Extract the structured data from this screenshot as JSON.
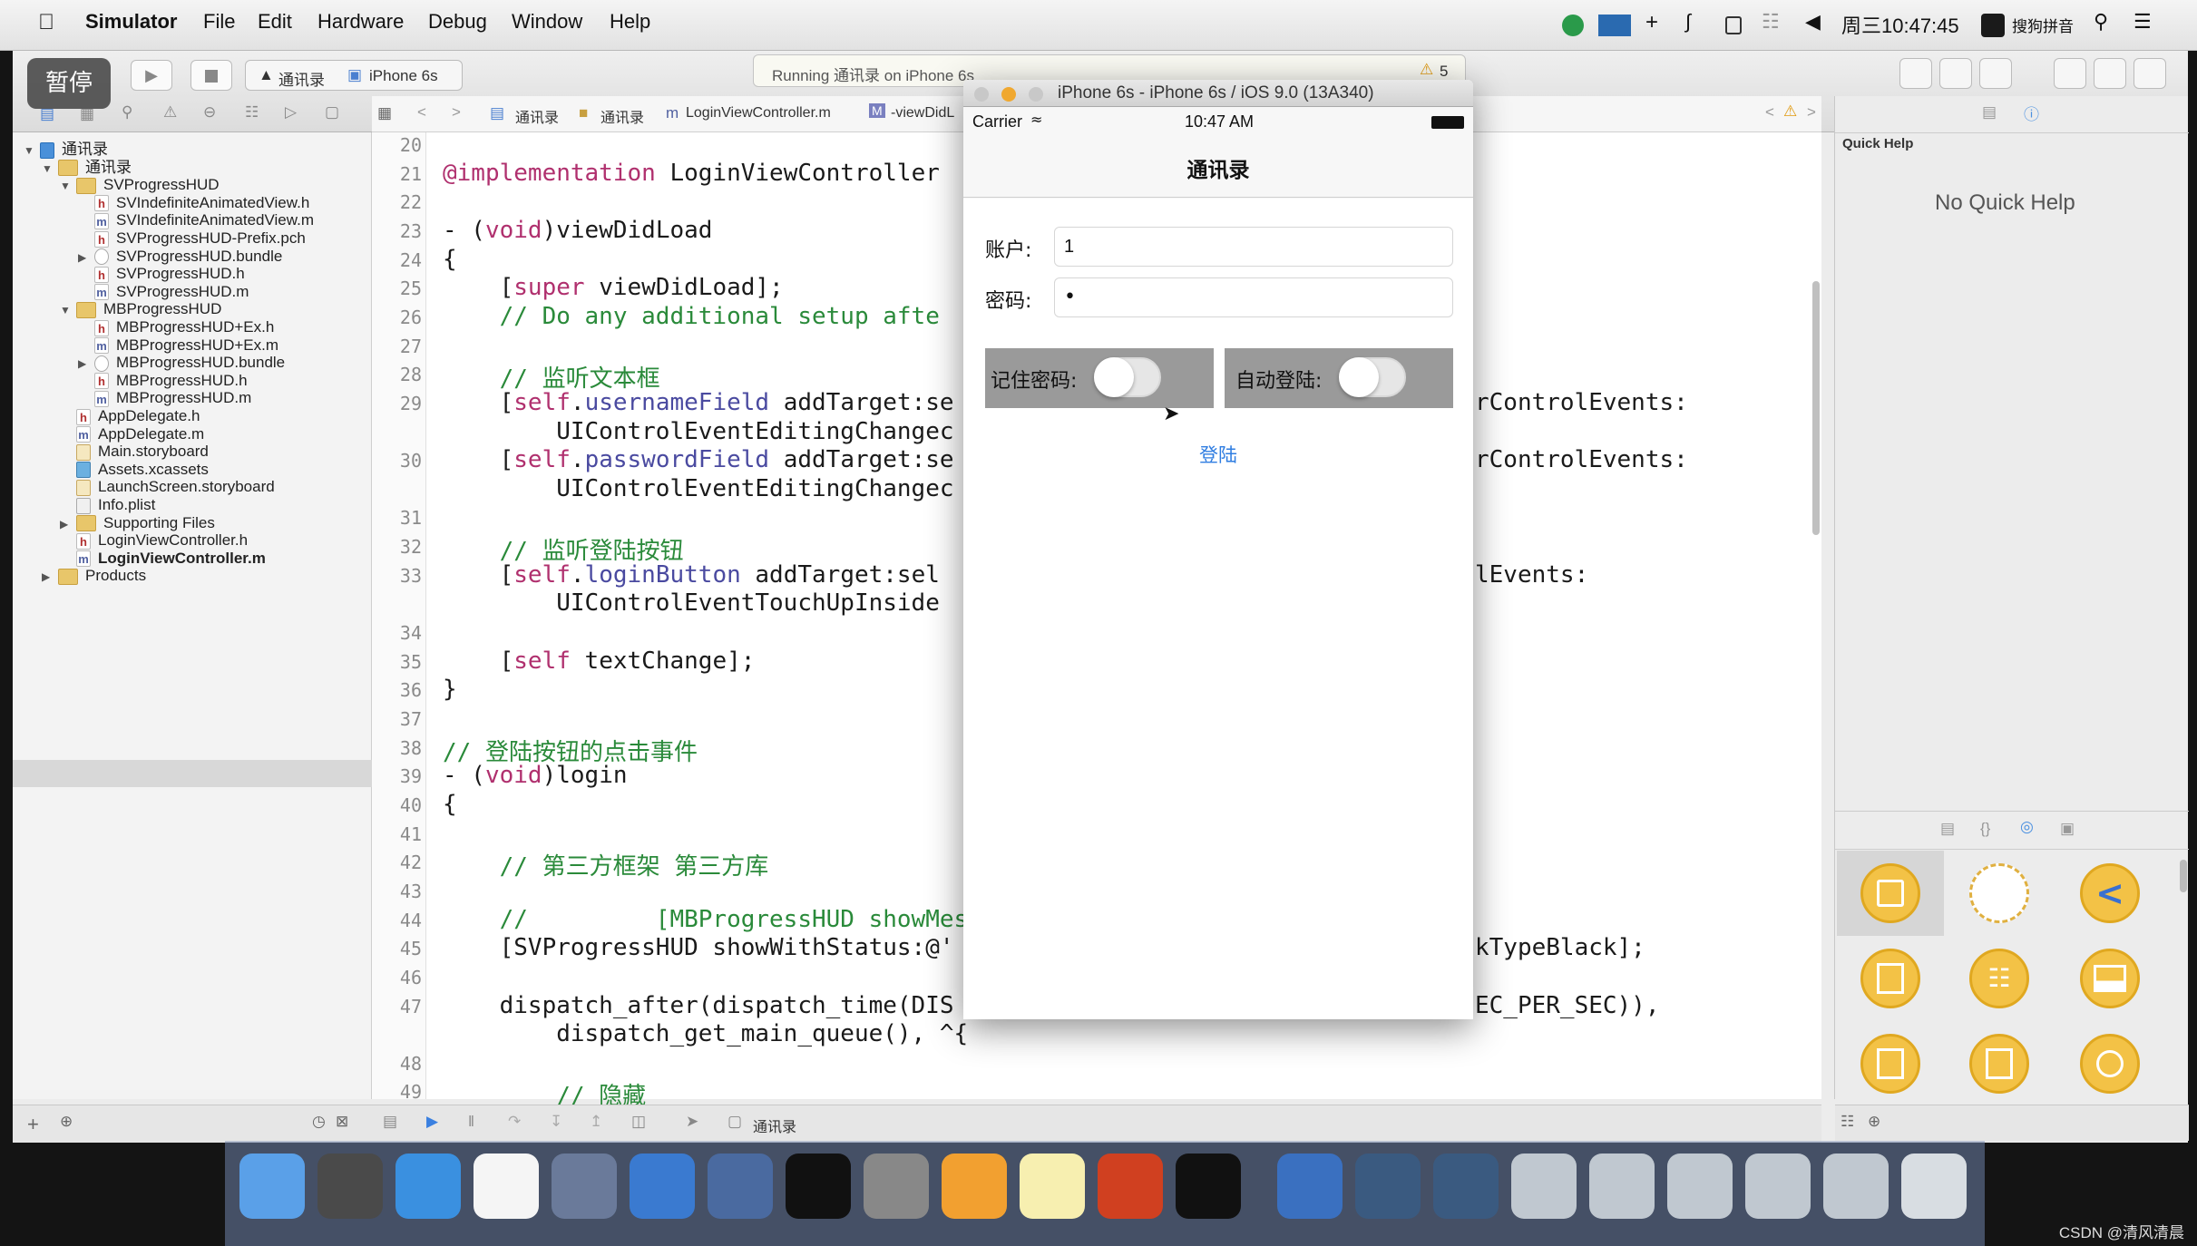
{
  "menubar": {
    "apple": "",
    "app": "Simulator",
    "items": [
      "File",
      "Edit",
      "Hardware",
      "Debug",
      "Window",
      "Help"
    ],
    "clock": "周三10:47:45",
    "ime": "搜狗拼音"
  },
  "toolbar": {
    "pause_badge": "暂停",
    "scheme": "通讯录",
    "device": "iPhone 6s",
    "status": "Running 通讯录 on iPhone 6s",
    "warnings": "5"
  },
  "jumpbar": {
    "crumbs": [
      "通讯录",
      "通讯录",
      "LoginViewController.m",
      "-viewDidL"
    ]
  },
  "navigator": {
    "items": [
      {
        "label": "通讯录",
        "icon": "project-icon",
        "depth": 0,
        "expand": "open"
      },
      {
        "label": "通讯录",
        "icon": "folder-icon",
        "depth": 1,
        "expand": "open"
      },
      {
        "label": "SVProgressHUD",
        "icon": "folder-icon",
        "depth": 2,
        "expand": "open"
      },
      {
        "label": "SVIndefiniteAnimatedView.h",
        "icon": "h-file-icon",
        "depth": 3
      },
      {
        "label": "SVIndefiniteAnimatedView.m",
        "icon": "m-file-icon",
        "depth": 3
      },
      {
        "label": "SVProgressHUD-Prefix.pch",
        "icon": "h-file-icon",
        "depth": 3
      },
      {
        "label": "SVProgressHUD.bundle",
        "icon": "bundle-icon",
        "depth": 3,
        "expand": "closed"
      },
      {
        "label": "SVProgressHUD.h",
        "icon": "h-file-icon",
        "depth": 3
      },
      {
        "label": "SVProgressHUD.m",
        "icon": "m-file-icon",
        "depth": 3
      },
      {
        "label": "MBProgressHUD",
        "icon": "folder-icon",
        "depth": 2,
        "expand": "open"
      },
      {
        "label": "MBProgressHUD+Ex.h",
        "icon": "h-file-icon",
        "depth": 3
      },
      {
        "label": "MBProgressHUD+Ex.m",
        "icon": "m-file-icon",
        "depth": 3
      },
      {
        "label": "MBProgressHUD.bundle",
        "icon": "bundle-icon",
        "depth": 3,
        "expand": "closed"
      },
      {
        "label": "MBProgressHUD.h",
        "icon": "h-file-icon",
        "depth": 3
      },
      {
        "label": "MBProgressHUD.m",
        "icon": "m-file-icon",
        "depth": 3
      },
      {
        "label": "AppDelegate.h",
        "icon": "h-file-icon",
        "depth": 2
      },
      {
        "label": "AppDelegate.m",
        "icon": "m-file-icon",
        "depth": 2
      },
      {
        "label": "Main.storyboard",
        "icon": "storyboard-icon",
        "depth": 2
      },
      {
        "label": "Assets.xcassets",
        "icon": "assets-icon",
        "depth": 2
      },
      {
        "label": "LaunchScreen.storyboard",
        "icon": "storyboard-icon",
        "depth": 2
      },
      {
        "label": "Info.plist",
        "icon": "plist-icon",
        "depth": 2
      },
      {
        "label": "Supporting Files",
        "icon": "folder-icon",
        "depth": 2,
        "expand": "closed"
      },
      {
        "label": "LoginViewController.h",
        "icon": "h-file-icon",
        "depth": 2
      },
      {
        "label": "LoginViewController.m",
        "icon": "m-file-icon",
        "depth": 2,
        "selected": true
      },
      {
        "label": "Products",
        "icon": "folder-icon",
        "depth": 1,
        "expand": "closed"
      }
    ]
  },
  "editor": {
    "lines": [
      {
        "n": "20",
        "code": []
      },
      {
        "n": "21",
        "code": [
          [
            "kw",
            "@implementation"
          ],
          [
            "",
            " LoginViewController"
          ]
        ]
      },
      {
        "n": "22",
        "code": []
      },
      {
        "n": "23",
        "code": [
          [
            "",
            "- ("
          ],
          [
            "kw",
            "void"
          ],
          [
            "",
            ")viewDidLoad"
          ]
        ]
      },
      {
        "n": "24",
        "code": [
          [
            "",
            "{"
          ]
        ]
      },
      {
        "n": "25",
        "code": [
          [
            "",
            "    ["
          ],
          [
            "kw",
            "super"
          ],
          [
            "",
            " viewDidLoad];"
          ]
        ]
      },
      {
        "n": "26",
        "code": [
          [
            "cm",
            "    // Do any additional setup afte"
          ]
        ]
      },
      {
        "n": "27",
        "code": []
      },
      {
        "n": "28",
        "code": [
          [
            "cm",
            "    // 监听文本框"
          ]
        ]
      },
      {
        "n": "29",
        "code": [
          [
            "",
            "    ["
          ],
          [
            "kw",
            "self"
          ],
          [
            "",
            "."
          ],
          [
            "prop",
            "usernameField"
          ],
          [
            "",
            " addTarget:se"
          ]
        ],
        "tail": "rControlEvents:"
      },
      {
        "n": "",
        "code": [
          [
            "",
            "        UIControlEventEditingChangec"
          ]
        ]
      },
      {
        "n": "30",
        "code": [
          [
            "",
            "    ["
          ],
          [
            "kw",
            "self"
          ],
          [
            "",
            "."
          ],
          [
            "prop",
            "passwordField"
          ],
          [
            "",
            " addTarget:se"
          ]
        ],
        "tail": "rControlEvents:"
      },
      {
        "n": "",
        "code": [
          [
            "",
            "        UIControlEventEditingChangec"
          ]
        ]
      },
      {
        "n": "31",
        "code": []
      },
      {
        "n": "32",
        "code": [
          [
            "cm",
            "    // 监听登陆按钮"
          ]
        ]
      },
      {
        "n": "33",
        "code": [
          [
            "",
            "    ["
          ],
          [
            "kw",
            "self"
          ],
          [
            "",
            "."
          ],
          [
            "prop",
            "loginButton"
          ],
          [
            "",
            " addTarget:sel"
          ]
        ],
        "tail": "lEvents:"
      },
      {
        "n": "",
        "code": [
          [
            "",
            "        UIControlEventTouchUpInside"
          ]
        ]
      },
      {
        "n": "34",
        "code": []
      },
      {
        "n": "35",
        "code": [
          [
            "",
            "    ["
          ],
          [
            "kw",
            "self"
          ],
          [
            "",
            " textChange];"
          ]
        ]
      },
      {
        "n": "36",
        "code": [
          [
            "",
            "}"
          ]
        ]
      },
      {
        "n": "37",
        "code": []
      },
      {
        "n": "38",
        "code": [
          [
            "cm",
            "// 登陆按钮的点击事件"
          ]
        ]
      },
      {
        "n": "39",
        "code": [
          [
            "",
            "- ("
          ],
          [
            "kw",
            "void"
          ],
          [
            "",
            ")login"
          ]
        ]
      },
      {
        "n": "40",
        "code": [
          [
            "",
            "{"
          ]
        ]
      },
      {
        "n": "41",
        "code": []
      },
      {
        "n": "42",
        "code": [
          [
            "cm",
            "    // 第三方框架 第三方库"
          ]
        ]
      },
      {
        "n": "43",
        "code": []
      },
      {
        "n": "44",
        "code": [
          [
            "cm",
            "    //         [MBProgressHUD showMes"
          ]
        ]
      },
      {
        "n": "45",
        "code": [
          [
            "",
            "    [SVProgressHUD showWithStatus:@'"
          ]
        ],
        "tail": "kTypeBlack];"
      },
      {
        "n": "46",
        "code": []
      },
      {
        "n": "47",
        "code": [
          [
            "",
            "    dispatch_after(dispatch_time(DIS"
          ]
        ],
        "tail": "EC_PER_SEC)),"
      },
      {
        "n": "",
        "code": [
          [
            "",
            "        dispatch_get_main_queue(), ^{"
          ]
        ]
      },
      {
        "n": "48",
        "code": []
      },
      {
        "n": "49",
        "code": [
          [
            "cm",
            "        // 隐藏"
          ]
        ]
      }
    ]
  },
  "bottombar": {
    "target": "通讯录"
  },
  "inspector": {
    "title": "Quick Help",
    "empty": "No Quick Help"
  },
  "simulator": {
    "title": "iPhone 6s - iPhone 6s / iOS 9.0 (13A340)",
    "carrier": "Carrier",
    "time": "10:47 AM",
    "nav_title": "通讯录",
    "account_label": "账户:",
    "account_value": "1",
    "password_label": "密码:",
    "password_value": "•",
    "remember_label": "记住密码:",
    "autologin_label": "自动登陆:",
    "login_button": "登陆"
  },
  "dock": {
    "apps": [
      "finder-icon",
      "launchpad-icon",
      "safari-icon",
      "mouse-icon",
      "photo-slideshow-icon",
      "xcode-icon",
      "instruments-icon",
      "terminal-icon",
      "system-preferences-icon",
      "sketch-icon",
      "notes-icon",
      "powerpoint-icon",
      "console-icon",
      "quicktime-icon",
      "window-icon",
      "window-icon",
      "window-icon",
      "window-icon",
      "window-icon",
      "window-icon",
      "window-icon",
      "trash-icon"
    ]
  },
  "watermark": "CSDN @清风清晨",
  "colors": {
    "keyword": "#b0306e",
    "comment": "#2a8a3a",
    "link": "#2f7de1",
    "library": "#f3c246"
  }
}
